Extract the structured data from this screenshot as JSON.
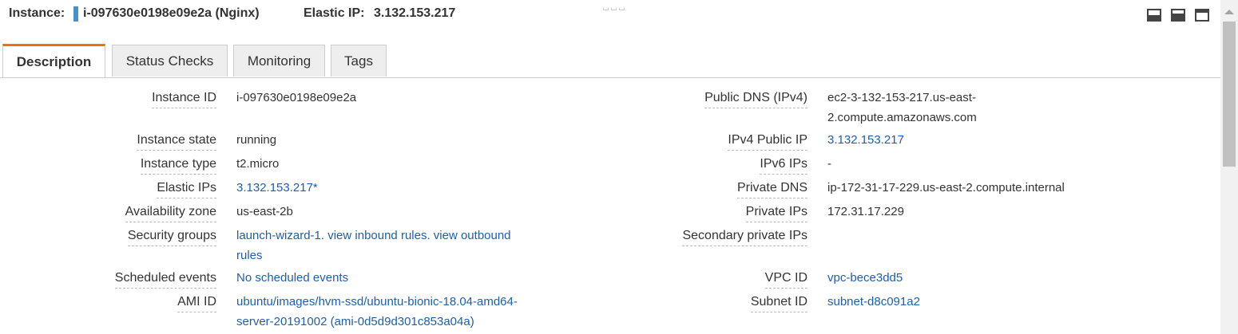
{
  "header": {
    "instance_label": "Instance:",
    "instance_value": "i-097630e0198e09e2a (Nginx)",
    "elastic_ip_label": "Elastic IP:",
    "elastic_ip_value": "3.132.153.217"
  },
  "tabs": [
    {
      "label": "Description",
      "active": true
    },
    {
      "label": "Status Checks",
      "active": false
    },
    {
      "label": "Monitoring",
      "active": false
    },
    {
      "label": "Tags",
      "active": false
    }
  ],
  "left": [
    {
      "label": "Instance ID",
      "value": "i-097630e0198e09e2a"
    },
    {
      "label": "Instance state",
      "value": "running"
    },
    {
      "label": "Instance type",
      "value": "t2.micro"
    },
    {
      "label": "Elastic IPs",
      "value": "3.132.153.217*"
    },
    {
      "label": "Availability zone",
      "value": "us-east-2b"
    },
    {
      "label": "Security groups",
      "value_line1": "launch-wizard-1. view inbound rules. view outbound",
      "value_line2": "rules"
    },
    {
      "label": "Scheduled events",
      "value": "No scheduled events"
    },
    {
      "label": "AMI ID",
      "value_line1": "ubuntu/images/hvm-ssd/ubuntu-bionic-18.04-amd64-",
      "value_line2": "server-20191002 (ami-0d5d9d301c853a04a)"
    }
  ],
  "right": [
    {
      "label": "Public DNS (IPv4)",
      "value_line1": "ec2-3-132-153-217.us-east-",
      "value_line2": "2.compute.amazonaws.com"
    },
    {
      "label": "IPv4 Public IP",
      "value": "3.132.153.217"
    },
    {
      "label": "IPv6 IPs",
      "value": "-"
    },
    {
      "label": "Private DNS",
      "value": "ip-172-31-17-229.us-east-2.compute.internal"
    },
    {
      "label": "Private IPs",
      "value": "172.31.17.229"
    },
    {
      "label": "Secondary private IPs",
      "value": ""
    },
    {
      "label": "VPC ID",
      "value": "vpc-bece3dd5"
    },
    {
      "label": "Subnet ID",
      "value": "subnet-d8c091a2"
    }
  ],
  "icons": {
    "pane_bottom": "pane-bottom-icon",
    "pane_half": "pane-half-icon",
    "pane_full": "pane-full-icon"
  },
  "colors": {
    "link": "#1f5fa8",
    "active_tab_accent": "#ec7211",
    "state_indicator": "#4a90c9"
  }
}
